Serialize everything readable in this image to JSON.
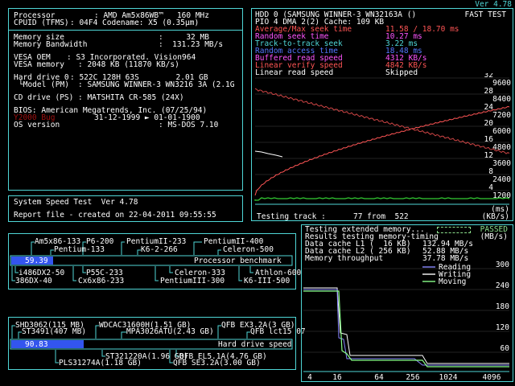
{
  "app": {
    "version": "Ver 4.78"
  },
  "system": {
    "processor_label": "Processor",
    "processor_value": "AMD Am5x86WB™   160 MHz",
    "cpuid_label": "CPUID (TFMS)",
    "cpuid_value": "04F4 Codename: X5 (0.35µm)",
    "memsize_label": "Memory size",
    "memsize_value": "32 MB",
    "membw_label": "Memory Bandwidth",
    "membw_value": "131.23 MB/s",
    "vesa_oem_label": "VESA OEM",
    "vesa_oem_value": "S3 Incorporated. Vision964",
    "vesa_mem_label": "VESA memory",
    "vesa_mem_value": "2048 KB (11870 KB/s)",
    "hdd_label": "Hard drive 0",
    "hdd_value": "522C 128H 63S        2.01 GB",
    "model_label": "└Model (PM)",
    "model_value": "SAMSUNG WINNER-3 WN3216 3A (2.1G",
    "cd_label": "CD drive (PS)",
    "cd_value": "MATSHITA CR-585 (24X)",
    "bios_label": "BIOS:",
    "bios_value": "American Megatrends, Inc. (07/25/94)",
    "y2k_label": "Y2000 Bug",
    "y2k_value": "31-12-1999 ► 01-01-1900",
    "os_label": "OS version",
    "os_value": "MS-DOS 7.10"
  },
  "speedtest": {
    "title": "System Speed Test  Ver 4.78",
    "report": "Report file - created on 22-04-2011 09:55:55"
  },
  "hdd_test": {
    "header": "HDD 0 (SAMSUNG WINNER-3 WN32163A ()",
    "mode": "FAST TEST",
    "pio": "PIO 4 DMA 2(2) Cache: 109 KB",
    "rows": [
      {
        "label": "Average/Max seek time",
        "value": "11.58 / 18.70 ms",
        "color": "#ff5555"
      },
      {
        "label": "Random seek time",
        "value": "10.27 ms",
        "color": "#ff55ff"
      },
      {
        "label": "Track-to-track seek",
        "value": "3.22 ms",
        "color": "#4fd6d6"
      },
      {
        "label": "Random access time",
        "value": "18.48 ms",
        "color": "#5577ff"
      },
      {
        "label": "Buffered read speed",
        "value": "4312 KB/s",
        "color": "#ff55ff"
      },
      {
        "label": "Linear verify speed",
        "value": "4842 KB/s",
        "color": "#ff5555"
      },
      {
        "label": "Linear read speed",
        "value": "Skipped",
        "color": "#ffffff"
      }
    ],
    "axis_left": [
      "32",
      "28",
      "24",
      "20",
      "16",
      "12",
      "8",
      "4"
    ],
    "axis_right": [
      "9600",
      "8400",
      "7200",
      "6000",
      "4800",
      "3600",
      "2400",
      "1200"
    ],
    "track_label": "Testing track :",
    "track_value": "77 from  522",
    "ms_unit": "(ms)",
    "kbs_unit": "(KB/s)"
  },
  "mem_test": {
    "line1": "Testing extended memory...",
    "passed": "PASSED",
    "line2": "Results testing memory-timing",
    "unit": "(MB/s)",
    "l1_label": "Data cache L1 (  16 KB)",
    "l1_value": "132.94 MB/s",
    "l2_label": "Data cache L2 ( 256 KB)",
    "l2_value": "52.88 MB/s",
    "tp_label": "Memory throughput",
    "tp_value": "37.78 MB/s",
    "y_ticks": [
      "300",
      "240",
      "180",
      "120",
      "60"
    ],
    "x_ticks": [
      "4",
      "16",
      "64",
      "256",
      "1024",
      "4096"
    ],
    "legend": [
      {
        "name": "Reading",
        "color": "#8888ff"
      },
      {
        "name": "Writing",
        "color": "#ffffff"
      },
      {
        "name": "Moving",
        "color": "#88ff88"
      }
    ]
  },
  "cpu_bench": {
    "score": "59.39",
    "caption": "Processor benchmark",
    "score_fraction": 0.15,
    "labels_above": [
      "Am5x86-133",
      "P6-200",
      "PentiumII-233",
      "PentiumII-400",
      "Pentium-133",
      "K6-2-266",
      "Celeron-500"
    ],
    "labels_below": [
      "i486DX2-50",
      "P55C-233",
      "Celeron-333",
      "Athlon-600",
      "386DX-40",
      "Cx6x86-233",
      "PentiumIII-300",
      "K6-III-500"
    ]
  },
  "hdd_bench": {
    "score": "90.83",
    "caption": "Hard drive speed",
    "score_fraction": 0.26,
    "labels_above": [
      "SHD3062(115 MB)",
      "WDCAC31600H(1.51 GB)",
      "QFB EX3.2A(3 GB)",
      "ST3491(407 MB)",
      "MPA3026ATU(2.43 GB)",
      "QFB lct15 07"
    ],
    "labels_below": [
      "ST321220A(1.96 GB)",
      "QFB EL5.1A(4.76 GB)",
      "PLS31274A(1.18 GB)",
      "QFB SE3.2A(3.00 GB)"
    ]
  }
}
